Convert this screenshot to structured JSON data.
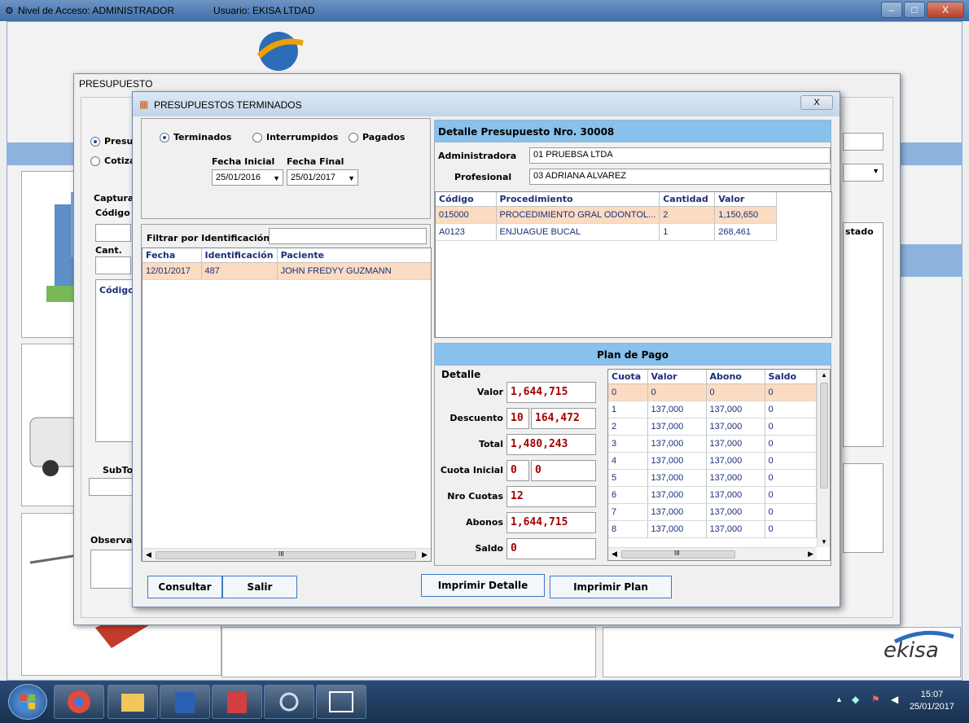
{
  "main_window": {
    "access_level": "Nivel de Acceso: ADMINISTRADOR",
    "user": "Usuario: EKISA LTDAD",
    "min": "–",
    "max": "□",
    "close": "X"
  },
  "logo_text": "ekisa",
  "background": {
    "presupuesto_title": "PRESUPUESTO",
    "radio_presupuesto": "Presu",
    "radio_cotizacion": "Cotiza",
    "captura_label": "Captura",
    "codigo_label": "Código",
    "cant_label": "Cant.",
    "grid_codigo_header": "Código",
    "estado_header": "stado",
    "subtotal_label": "SubTo",
    "observaciones_label": "Observac"
  },
  "dialog": {
    "title": "PRESUPUESTOS TERMINADOS",
    "close": "X",
    "status_options": [
      {
        "label": "Terminados",
        "selected": true
      },
      {
        "label": "Interrumpidos",
        "selected": false
      },
      {
        "label": "Pagados",
        "selected": false
      }
    ],
    "fecha_inicial_label": "Fecha Inicial",
    "fecha_final_label": "Fecha Final",
    "fecha_inicial": "25/01/2016",
    "fecha_final": "25/01/2017",
    "filter_label": "Filtrar por Identificación",
    "filter_value": "",
    "list": {
      "headers": [
        "Fecha",
        "Identificación",
        "Paciente"
      ],
      "rows": [
        [
          "12/01/2017",
          "487",
          "JOHN FREDYY GUZMANN"
        ]
      ]
    },
    "scroll_mark": "III",
    "detail": {
      "title": "Detalle Presupuesto Nro. 30008",
      "administradora_label": "Administradora",
      "administradora_value": "01 PRUEBSA LTDA",
      "profesional_label": "Profesional",
      "profesional_value": "03 ADRIANA ALVAREZ",
      "proc_headers": [
        "Código",
        "Procedimiento",
        "Cantidad",
        "Valor"
      ],
      "proc_rows": [
        [
          "015000",
          "PROCEDIMIENTO GRAL ODONTOL...",
          "2",
          "1,150,650"
        ],
        [
          "A0123",
          "ENJUAGUE BUCAL",
          "1",
          "268,461"
        ]
      ]
    },
    "plan": {
      "title": "Plan de Pago",
      "detalle_label": "Detalle",
      "valor_label": "Valor",
      "valor": "1,644,715",
      "descuento_label": "Descuento",
      "descuento_pct": "10",
      "descuento": "164,472",
      "total_label": "Total",
      "total": "1,480,243",
      "cuota_inicial_label": "Cuota Inicial",
      "cuota_inicial_a": "0",
      "cuota_inicial_b": "0",
      "nro_cuotas_label": "Nro Cuotas",
      "nro_cuotas": "12",
      "abonos_label": "Abonos",
      "abonos": "1,644,715",
      "saldo_label": "Saldo",
      "saldo": "0",
      "cuotas_headers": [
        "Cuota",
        "Valor",
        "Abono",
        "Saldo"
      ],
      "cuotas_rows": [
        [
          "0",
          "0",
          "0",
          "0"
        ],
        [
          "1",
          "137,000",
          "137,000",
          "0"
        ],
        [
          "2",
          "137,000",
          "137,000",
          "0"
        ],
        [
          "3",
          "137,000",
          "137,000",
          "0"
        ],
        [
          "4",
          "137,000",
          "137,000",
          "0"
        ],
        [
          "5",
          "137,000",
          "137,000",
          "0"
        ],
        [
          "6",
          "137,000",
          "137,000",
          "0"
        ],
        [
          "7",
          "137,000",
          "137,000",
          "0"
        ],
        [
          "8",
          "137,000",
          "137,000",
          "0"
        ]
      ]
    },
    "buttons": {
      "consultar": "Consultar",
      "salir": "Salir",
      "imprimir_detalle": "Imprimir Detalle",
      "imprimir_plan": "Imprimir Plan"
    }
  },
  "taskbar": {
    "time": "15:07",
    "date": "25/01/2017"
  },
  "colors": {
    "accent_blue": "#87c1ec",
    "selected_row": "#fbdcc2",
    "value_red": "#a40000",
    "header_text": "#1b2f7a"
  }
}
